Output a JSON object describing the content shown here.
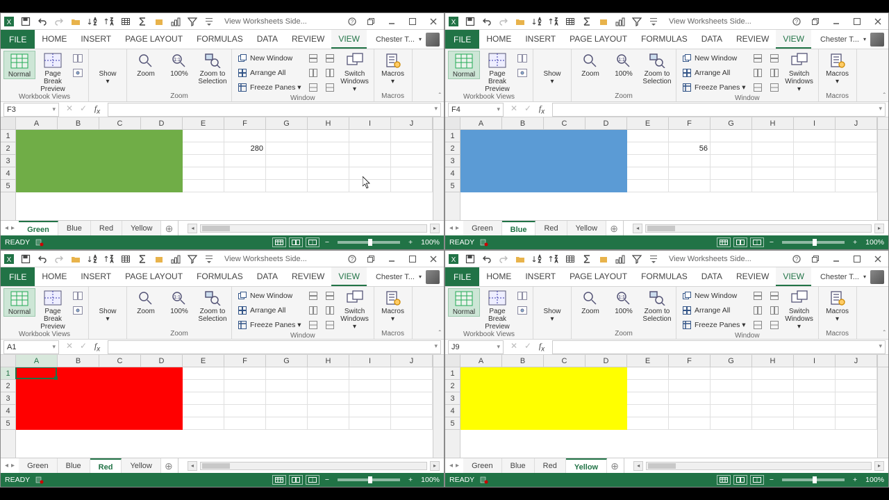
{
  "columns": [
    "A",
    "B",
    "C",
    "D",
    "E",
    "F",
    "G",
    "H",
    "I",
    "J"
  ],
  "rows": [
    "1",
    "2",
    "3",
    "4",
    "5"
  ],
  "ribbon_tabs": [
    "HOME",
    "INSERT",
    "PAGE LAYOUT",
    "FORMULAS",
    "DATA",
    "REVIEW",
    "VIEW"
  ],
  "file_tab": "FILE",
  "user_name": "Chester T...",
  "title_text": "View Worksheets Side...",
  "group_labels": {
    "views": "Workbook Views",
    "zoom": "Zoom",
    "window": "Window",
    "macros": "Macros"
  },
  "view_buttons": {
    "normal": "Normal",
    "page_break": "Page Break\nPreview",
    "show": "Show",
    "zoom": "Zoom",
    "pct100": "100%",
    "zoom_sel": "Zoom to\nSelection",
    "switch": "Switch\nWindows",
    "macros": "Macros"
  },
  "window_cmds": {
    "new": "New Window",
    "arrange": "Arrange All",
    "freeze": "Freeze Panes"
  },
  "sheet_tabs": [
    "Green",
    "Blue",
    "Red",
    "Yellow"
  ],
  "status": {
    "ready": "READY",
    "zoom": "100%"
  },
  "windows": [
    {
      "name_box": "F3",
      "active_tab": 0,
      "fill": "#70AD47",
      "cell_value": "280",
      "value_col": 5,
      "sel_col": "",
      "sel_row": "",
      "active_cell_pos": null
    },
    {
      "name_box": "F4",
      "active_tab": 1,
      "fill": "#5B9BD5",
      "cell_value": "56",
      "value_col": 5,
      "sel_col": "",
      "sel_row": "",
      "active_cell_pos": null
    },
    {
      "name_box": "A1",
      "active_tab": 2,
      "fill": "#FF0000",
      "cell_value": "",
      "value_col": 5,
      "sel_col": "A",
      "sel_row": "1",
      "active_cell_pos": {
        "r": 0,
        "c": 0
      }
    },
    {
      "name_box": "J9",
      "active_tab": 3,
      "fill": "#FFFF00",
      "cell_value": "",
      "value_col": 5,
      "sel_col": "",
      "sel_row": "",
      "active_cell_pos": null
    }
  ],
  "chart_data": {
    "type": "table",
    "note": "four tiled Excel windows, same workbook, sheets Green/Blue/Red/Yellow; F2=280 on Green, F2=56 on Blue"
  }
}
